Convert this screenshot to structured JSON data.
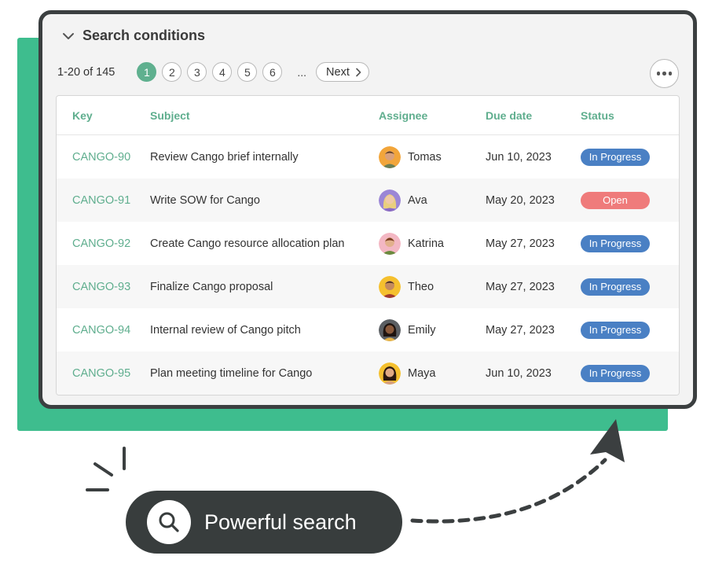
{
  "colors": {
    "green": "#3ebd8e",
    "accent": "#5fae8e",
    "dark": "#3b3f40",
    "in_progress": "#4a80c4",
    "open": "#ef7b7b"
  },
  "conditions": {
    "title": "Search conditions",
    "icon": "chevron-down-icon"
  },
  "pager": {
    "range": "1-20 of 145",
    "pages": [
      "1",
      "2",
      "3",
      "4",
      "5",
      "6"
    ],
    "active_page": "1",
    "ellipsis": "...",
    "next": "Next"
  },
  "table": {
    "headers": {
      "key": "Key",
      "subject": "Subject",
      "assignee": "Assignee",
      "due": "Due date",
      "status": "Status"
    },
    "rows": [
      {
        "key": "CANGO-90",
        "subject": "Review Cango brief internally",
        "assignee": "Tomas",
        "due": "Jun 10, 2023",
        "status": "In Progress"
      },
      {
        "key": "CANGO-91",
        "subject": "Write SOW for Cango",
        "assignee": "Ava",
        "due": "May 20, 2023",
        "status": "Open"
      },
      {
        "key": "CANGO-92",
        "subject": "Create Cango resource allocation plan",
        "assignee": "Katrina",
        "due": "May 27, 2023",
        "status": "In Progress"
      },
      {
        "key": "CANGO-93",
        "subject": "Finalize Cango proposal",
        "assignee": "Theo",
        "due": "May 27, 2023",
        "status": "In Progress"
      },
      {
        "key": "CANGO-94",
        "subject": "Internal review of Cango pitch",
        "assignee": "Emily",
        "due": "May 27, 2023",
        "status": "In Progress"
      },
      {
        "key": "CANGO-95",
        "subject": "Plan meeting timeline for Cango",
        "assignee": "Maya",
        "due": "Jun 10, 2023",
        "status": "In Progress"
      }
    ]
  },
  "callout": {
    "label": "Powerful search",
    "icon": "search-icon"
  }
}
